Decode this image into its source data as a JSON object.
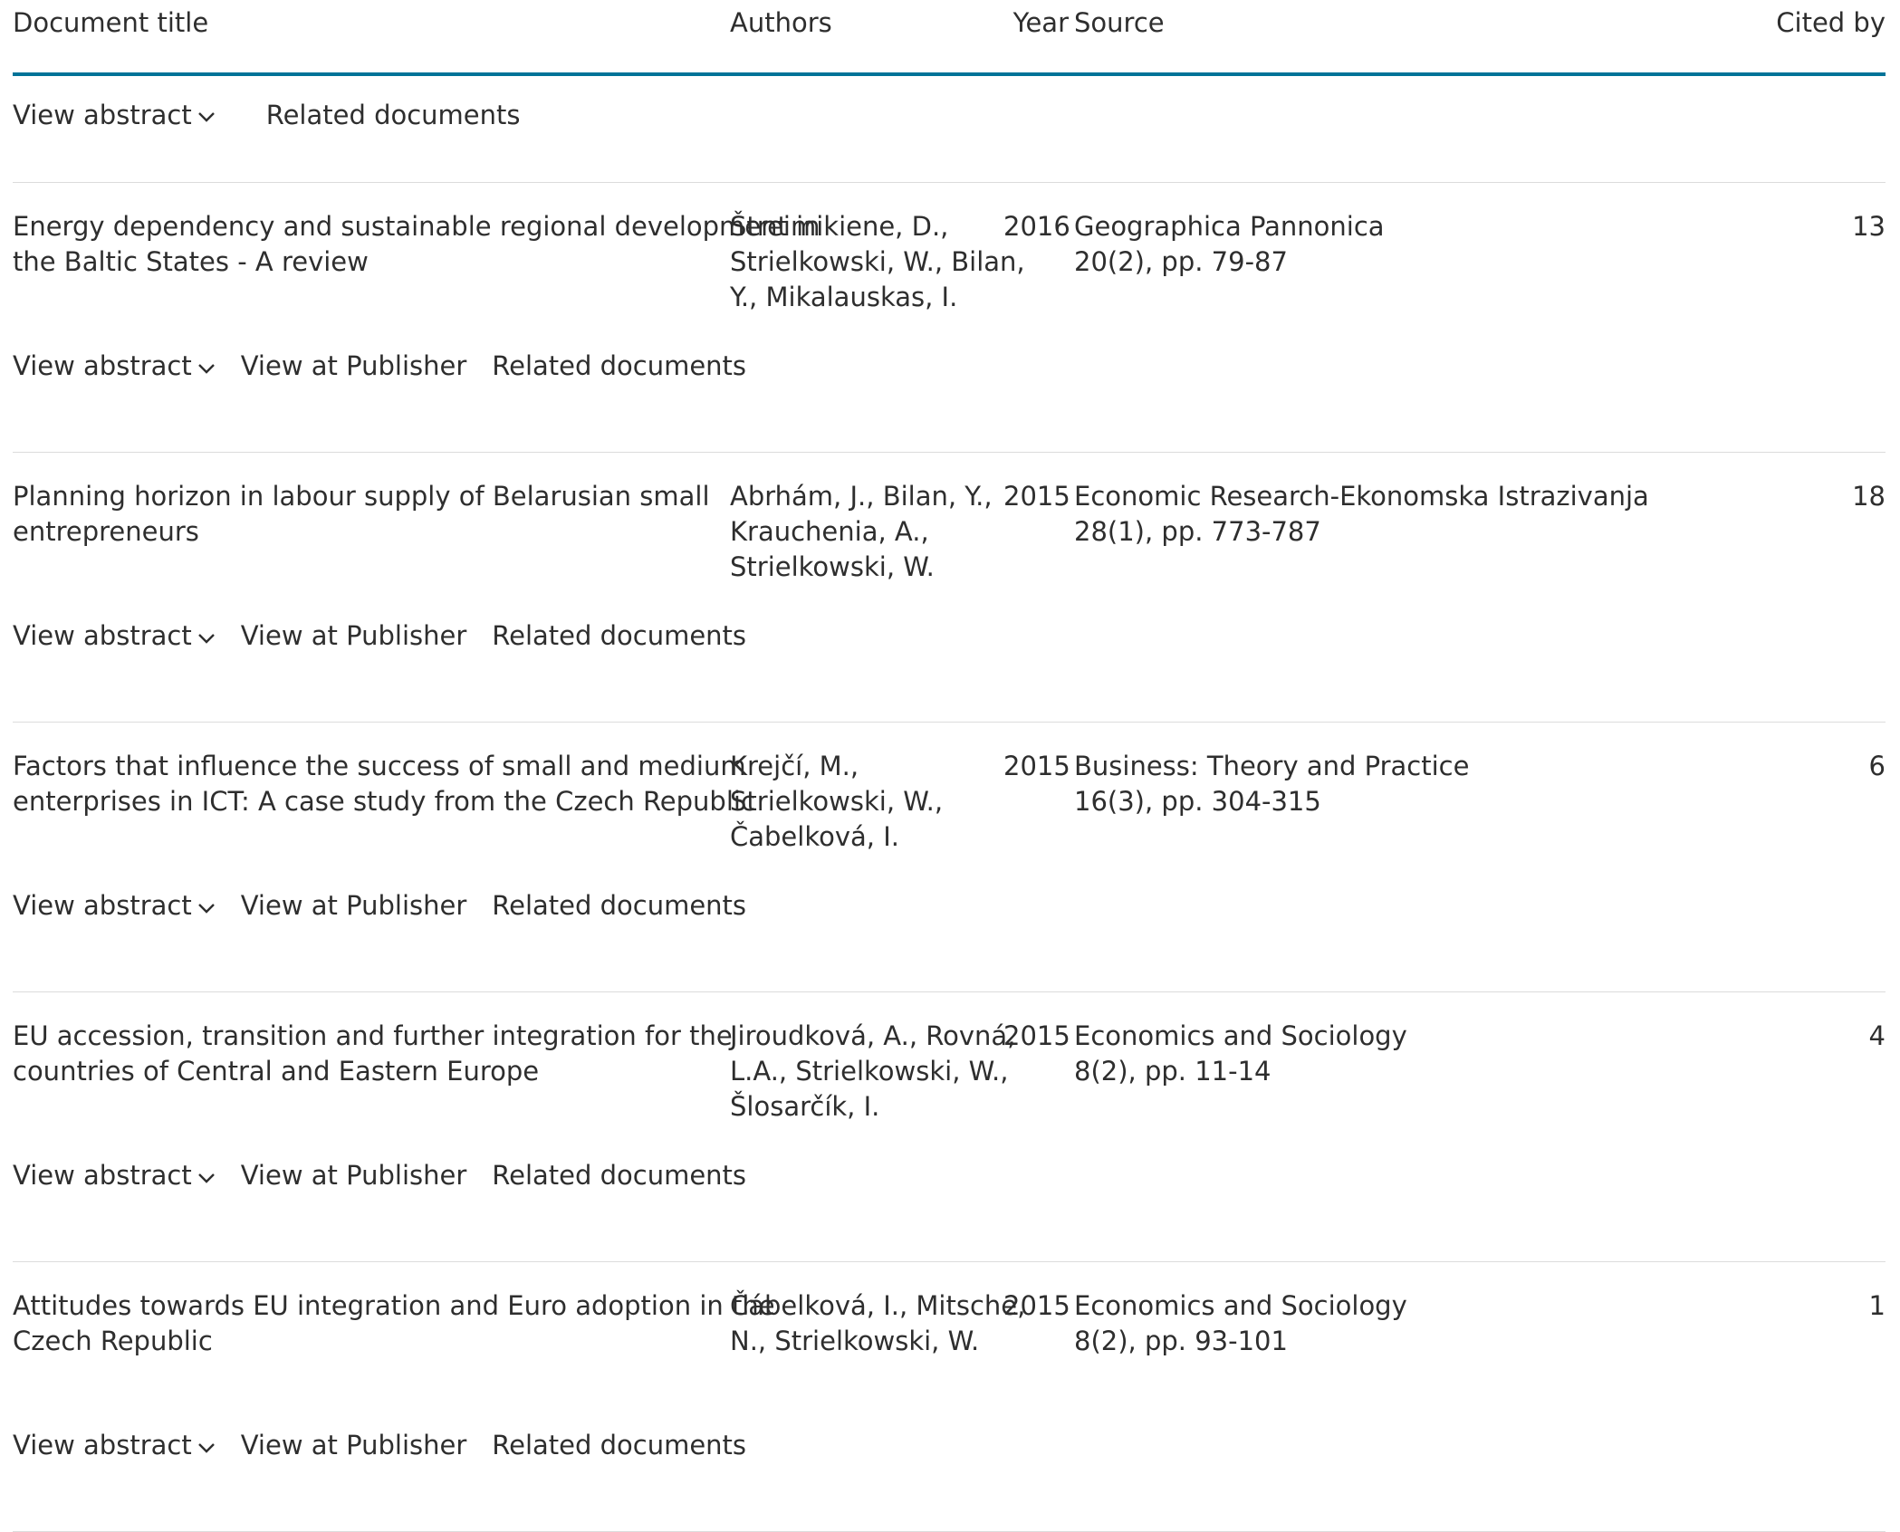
{
  "columns": {
    "title": "Document title",
    "authors": "Authors",
    "year": "Year",
    "source": "Source",
    "cited_by": "Cited by"
  },
  "first_actions": {
    "view_abstract": "View abstract",
    "related_documents": "Related documents"
  },
  "actions": {
    "view_abstract": "View abstract",
    "view_at_publisher": "View at Publisher",
    "related_documents": "Related documents"
  },
  "rows": [
    {
      "title_line1": "Energy dependency and sustainable regional development in",
      "title_line2": "the Baltic States - A review",
      "authors_line1": "Štreimikiene, D.,",
      "authors_line2": "Strielkowski, W., Bilan,",
      "authors_line3": "Y., Mikalauskas, I.",
      "year": "2016",
      "source_name": "Geographica Pannonica",
      "source_detail": "20(2), pp. 79-87",
      "cited_by": "13"
    },
    {
      "title_line1": "Planning horizon in labour supply of Belarusian small",
      "title_line2": "entrepreneurs",
      "authors_line1": "Abrhám, J., Bilan, Y.,",
      "authors_line2": "Krauchenia, A.,",
      "authors_line3": "Strielkowski, W.",
      "year": "2015",
      "source_name": "Economic Research-Ekonomska Istrazivanja",
      "source_detail": "28(1), pp. 773-787",
      "cited_by": "18"
    },
    {
      "title_line1": "Factors that influence the success of small and medium",
      "title_line2": "enterprises in ICT: A case study from the Czech Republic",
      "authors_line1": "Krejčí, M.,",
      "authors_line2": "Strielkowski, W.,",
      "authors_line3": "Čabelková, I.",
      "year": "2015",
      "source_name": "Business: Theory and Practice",
      "source_detail": "16(3), pp. 304-315",
      "cited_by": "6"
    },
    {
      "title_line1": "EU accession, transition and further integration for the",
      "title_line2": "countries of Central and Eastern Europe",
      "authors_line1": "Jiroudková, A., Rovná,",
      "authors_line2": "L.A., Strielkowski, W.,",
      "authors_line3": "Šlosarčík, I.",
      "year": "2015",
      "source_name": "Economics and Sociology",
      "source_detail": "8(2), pp. 11-14",
      "cited_by": "4"
    },
    {
      "title_line1": "Attitudes towards EU integration and Euro adoption in the",
      "title_line2": "Czech Republic",
      "authors_line1": "Čábelková, I., Mitsche,",
      "authors_line2": "N., Strielkowski, W.",
      "authors_line3": "",
      "year": "2015",
      "source_name": "Economics and Sociology",
      "source_detail": "8(2), pp. 93-101",
      "cited_by": "1"
    }
  ],
  "colors": {
    "accent": "#007398",
    "text": "#2e2e2e",
    "separator": "#dcdcdc"
  },
  "icons": {
    "expand": "chevron-down-icon"
  }
}
